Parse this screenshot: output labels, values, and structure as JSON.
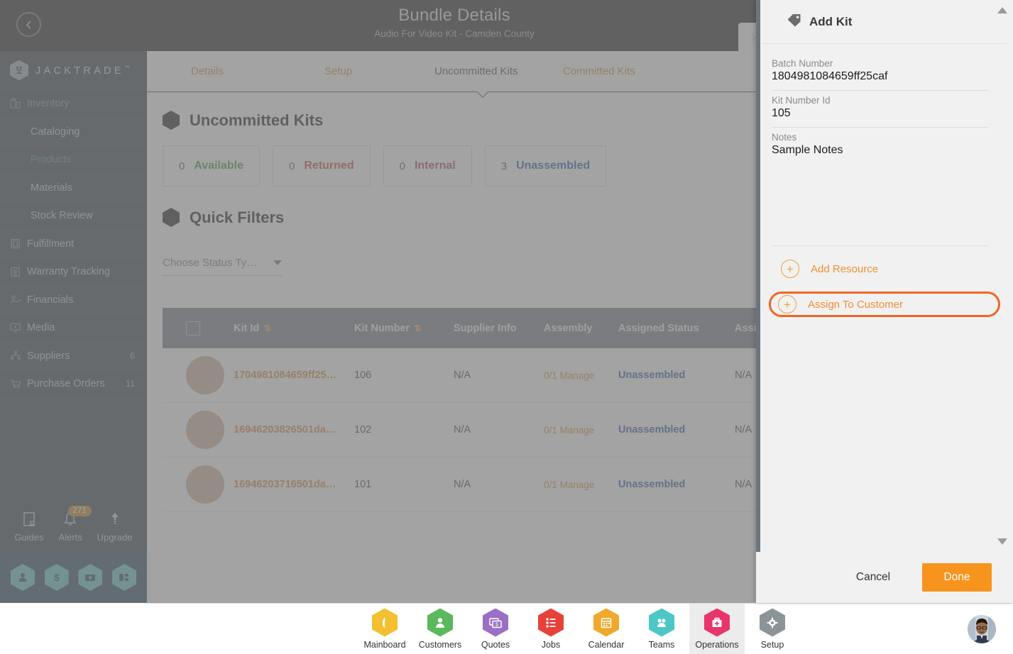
{
  "header": {
    "title": "Bundle Details",
    "subtitle": "Audio For Video Kit - Camden County",
    "back_icon": "chevron-left-icon",
    "forward_icon": "chevron-right-icon"
  },
  "sidebar": {
    "brand": "JACKTRADE",
    "brand_tm": "™",
    "items": [
      {
        "label": "Inventory",
        "icon": "inventory-icon",
        "type": "group",
        "count": ""
      },
      {
        "label": "Cataloging",
        "icon": "",
        "type": "sub",
        "count": ""
      },
      {
        "label": "Products",
        "icon": "",
        "type": "sub-active",
        "count": ""
      },
      {
        "label": "Materials",
        "icon": "",
        "type": "sub",
        "count": ""
      },
      {
        "label": "Stock Review",
        "icon": "",
        "type": "sub",
        "count": ""
      },
      {
        "label": "Fulfillment",
        "icon": "fulfillment-icon",
        "type": "item",
        "count": ""
      },
      {
        "label": "Warranty Tracking",
        "icon": "warranty-icon",
        "type": "item",
        "count": ""
      },
      {
        "label": "Financials",
        "icon": "financials-icon",
        "type": "item",
        "count": ""
      },
      {
        "label": "Media",
        "icon": "media-icon",
        "type": "item",
        "count": ""
      },
      {
        "label": "Suppliers",
        "icon": "suppliers-icon",
        "type": "item",
        "count": "6"
      },
      {
        "label": "Purchase Orders",
        "icon": "purchase-orders-icon",
        "type": "item",
        "count": "11"
      }
    ],
    "tools": [
      {
        "label": "Guides",
        "icon": "book-icon",
        "badge": ""
      },
      {
        "label": "Alerts",
        "icon": "bell-icon",
        "badge": "271"
      },
      {
        "label": "Upgrade",
        "icon": "upgrade-arrow-icon",
        "badge": ""
      }
    ],
    "quick_hex": [
      "person-icon",
      "dollar-icon",
      "payment-icon",
      "workflow-icon"
    ]
  },
  "main": {
    "tabs": [
      {
        "label": "Details",
        "active": false
      },
      {
        "label": "Setup",
        "active": false
      },
      {
        "label": "Uncommitted Kits",
        "active": true
      },
      {
        "label": "Committed Kits",
        "active": false
      }
    ],
    "section_title": "Uncommitted Kits",
    "stats": [
      {
        "count": "0",
        "label": "Available",
        "color": "#3c8f3c"
      },
      {
        "count": "0",
        "label": "Returned",
        "color": "#c0392b"
      },
      {
        "count": "0",
        "label": "Internal",
        "color": "#a03a52"
      },
      {
        "count": "3",
        "label": "Unassembled",
        "color": "#1a4f9c"
      }
    ],
    "quick_filters_title": "Quick Filters",
    "status_select": {
      "value": "Choose Status Ty…",
      "icon": "chevron-down-icon"
    },
    "table": {
      "columns": [
        {
          "label": "",
          "sortable": false
        },
        {
          "label": "Kit Id",
          "sortable": true
        },
        {
          "label": "Kit Number",
          "sortable": true
        },
        {
          "label": "Supplier Info",
          "sortable": false
        },
        {
          "label": "Assembly",
          "sortable": false
        },
        {
          "label": "Assigned Status",
          "sortable": false
        },
        {
          "label": "Assign",
          "sortable": false
        }
      ],
      "rows": [
        {
          "kit_id": "1704981084659ff25…",
          "kit_number": "106",
          "supplier_info": "N/A",
          "assembly": "0/1 Manage",
          "assigned_status": "Unassembled",
          "assigned_on": "N/A"
        },
        {
          "kit_id": "16946203826501da…",
          "kit_number": "102",
          "supplier_info": "N/A",
          "assembly": "0/1 Manage",
          "assigned_status": "Unassembled",
          "assigned_on": "N/A"
        },
        {
          "kit_id": "16946203716501da…",
          "kit_number": "101",
          "supplier_info": "N/A",
          "assembly": "0/1 Manage",
          "assigned_status": "Unassembled",
          "assigned_on": "N/A"
        }
      ]
    }
  },
  "panel": {
    "title": "Add Kit",
    "title_icon": "tag-icon",
    "fields": [
      {
        "label": "Batch Number",
        "value": "1804981084659ff25caf"
      },
      {
        "label": "Kit Number Id",
        "value": "105"
      },
      {
        "label": "Notes",
        "value": "Sample Notes"
      }
    ],
    "actions": [
      {
        "label": "Add Resource",
        "icon": "plus-circle-icon",
        "highlighted": false
      },
      {
        "label": "Assign To Customer",
        "icon": "plus-circle-icon",
        "highlighted": true
      }
    ],
    "cancel_label": "Cancel",
    "done_label": "Done",
    "highlight_color": "#f26522",
    "accent_color": "#ef8f32"
  },
  "bottom_nav": [
    {
      "label": "Mainboard",
      "icon": "mainboard-icon",
      "color": "#f3c032",
      "selected": false
    },
    {
      "label": "Customers",
      "icon": "customers-icon",
      "color": "#5cb85c",
      "selected": false
    },
    {
      "label": "Quotes",
      "icon": "quotes-icon",
      "color": "#9b6fc4",
      "selected": false
    },
    {
      "label": "Jobs",
      "icon": "jobs-icon",
      "color": "#e8413a",
      "selected": false
    },
    {
      "label": "Calendar",
      "icon": "calendar-icon",
      "color": "#f0a92c",
      "selected": false
    },
    {
      "label": "Teams",
      "icon": "teams-icon",
      "color": "#4dc6c6",
      "selected": false
    },
    {
      "label": "Operations",
      "icon": "operations-icon",
      "color": "#e8356b",
      "selected": true
    },
    {
      "label": "Setup",
      "icon": "gear-icon",
      "color": "#8d9498",
      "selected": false
    }
  ]
}
